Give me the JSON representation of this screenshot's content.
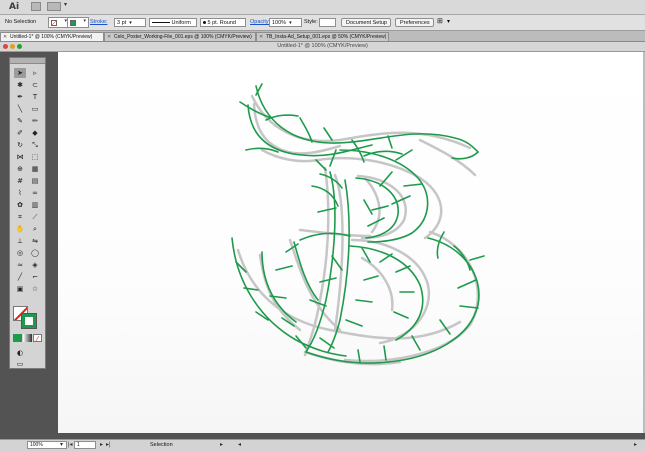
{
  "app": {
    "logo": "Ai"
  },
  "control_bar": {
    "selection_label": "No Selection",
    "stroke_label": "Stroke:",
    "stroke_weight": "3 pt",
    "profile": "Uniform",
    "brush": "5 pt. Round",
    "opacity_label": "Opacity:",
    "opacity_value": "100%",
    "style_label": "Style:",
    "document_setup": "Document Setup",
    "preferences": "Preferences"
  },
  "tabs": [
    {
      "label": "Untitled-1* @ 100% (CMYK/Preview)",
      "active": true
    },
    {
      "label": "Celo_Poster_Working-File_001.eps @ 100% (CMYK/Preview)",
      "active": false
    },
    {
      "label": "TB_Insta-Ad_Setup_001.eps @ 50% (CMYK/Preview)",
      "active": false
    }
  ],
  "window": {
    "title": "Untitled-1* @ 100% (CMYK/Preview)"
  },
  "status": {
    "zoom": "100%",
    "artboard": "1",
    "tool": "Selection"
  },
  "colors": {
    "accent_green": "#1e9a4c",
    "sketch_gray": "#c6c6c6",
    "canvas": "#ffffff",
    "chrome": "#535353"
  },
  "tools": [
    "selection-tool",
    "direct-selection-tool",
    "magic-wand-tool",
    "lasso-tool",
    "pen-tool",
    "type-tool",
    "line-segment-tool",
    "rectangle-tool",
    "paintbrush-tool",
    "pencil-tool",
    "blob-brush-tool",
    "eraser-tool",
    "rotate-tool",
    "scale-tool",
    "width-tool",
    "free-transform-tool",
    "shape-builder-tool",
    "perspective-grid-tool",
    "mesh-tool",
    "gradient-tool",
    "eyedropper-tool",
    "blend-tool",
    "symbol-sprayer-tool",
    "column-graph-tool",
    "artboard-tool",
    "slice-tool",
    "hand-tool",
    "zoom-tool"
  ]
}
